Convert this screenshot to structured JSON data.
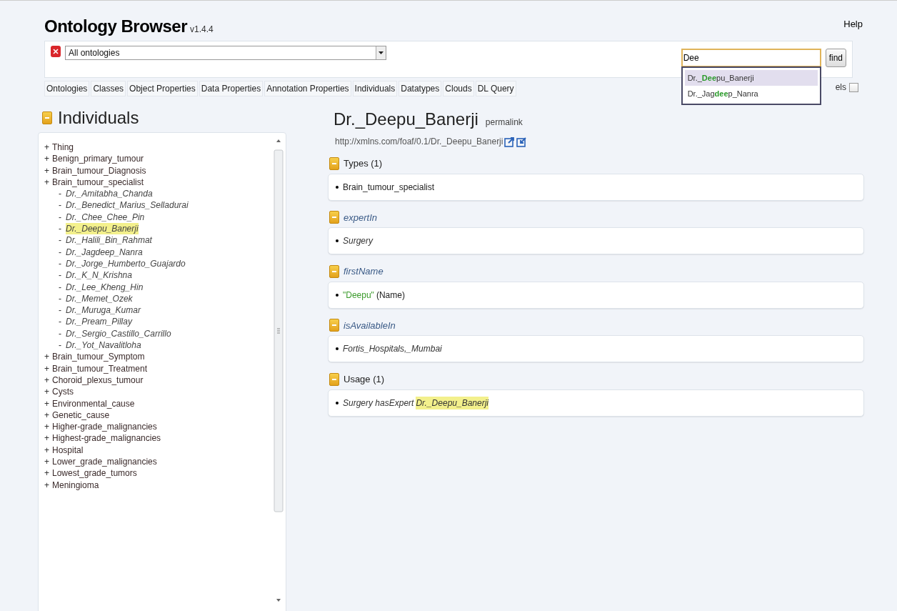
{
  "header": {
    "title": "Ontology Browser",
    "version": "v1.4.4",
    "help": "Help"
  },
  "toolbar": {
    "ontology_select": {
      "value": "All ontologies"
    },
    "search": {
      "value": "Dee"
    },
    "find_button": "find",
    "suggestions": [
      {
        "selected": true,
        "parts": [
          {
            "text": "Dr._",
            "match": false
          },
          {
            "text": "Dee",
            "match": true
          },
          {
            "text": "pu_Banerji",
            "match": false
          }
        ]
      },
      {
        "selected": false,
        "parts": [
          {
            "text": "Dr._Jag",
            "match": false
          },
          {
            "text": "dee",
            "match": true
          },
          {
            "text": "p_Nanra",
            "match": false
          }
        ]
      }
    ],
    "render_labels": {
      "label": "els",
      "checked": false
    }
  },
  "tabs": [
    "Ontologies",
    "Classes",
    "Object Properties",
    "Data Properties",
    "Annotation Properties",
    "Individuals",
    "Datatypes",
    "Clouds",
    "DL Query"
  ],
  "sidebar": {
    "title": "Individuals",
    "tree": [
      {
        "marker": "+",
        "label": "Thing"
      },
      {
        "marker": "+",
        "label": "Benign_primary_tumour"
      },
      {
        "marker": "+",
        "label": "Brain_tumour_Diagnosis"
      },
      {
        "marker": "+",
        "label": "Brain_tumour_specialist",
        "children": [
          {
            "marker": "-",
            "label": "Dr._Amitabha_Chanda",
            "selected": false
          },
          {
            "marker": "-",
            "label": "Dr._Benedict_Marius_Selladurai",
            "selected": false
          },
          {
            "marker": "-",
            "label": "Dr._Chee_Chee_Pin",
            "selected": false
          },
          {
            "marker": "-",
            "label": "Dr._Deepu_Banerji",
            "selected": true
          },
          {
            "marker": "-",
            "label": "Dr._Halili_Bin_Rahmat",
            "selected": false
          },
          {
            "marker": "-",
            "label": "Dr._Jagdeep_Nanra",
            "selected": false
          },
          {
            "marker": "-",
            "label": "Dr._Jorge_Humberto_Guajardo",
            "selected": false
          },
          {
            "marker": "-",
            "label": "Dr._K_N_Krishna",
            "selected": false
          },
          {
            "marker": "-",
            "label": "Dr._Lee_Kheng_Hin",
            "selected": false
          },
          {
            "marker": "-",
            "label": "Dr._Memet_Ozek",
            "selected": false
          },
          {
            "marker": "-",
            "label": "Dr._Muruga_Kumar",
            "selected": false
          },
          {
            "marker": "-",
            "label": "Dr._Pream_Pillay",
            "selected": false
          },
          {
            "marker": "-",
            "label": "Dr._Sergio_Castillo_Carrillo",
            "selected": false
          },
          {
            "marker": "-",
            "label": "Dr._Yot_Navalitloha",
            "selected": false
          }
        ]
      },
      {
        "marker": "+",
        "label": "Brain_tumour_Symptom"
      },
      {
        "marker": "+",
        "label": "Brain_tumour_Treatment"
      },
      {
        "marker": "+",
        "label": "Choroid_plexus_tumour"
      },
      {
        "marker": "+",
        "label": "Cysts"
      },
      {
        "marker": "+",
        "label": "Environmental_cause"
      },
      {
        "marker": "+",
        "label": "Genetic_cause"
      },
      {
        "marker": "+",
        "label": "Higher-grade_malignancies"
      },
      {
        "marker": "+",
        "label": "Highest-grade_malignancies"
      },
      {
        "marker": "+",
        "label": "Hospital"
      },
      {
        "marker": "+",
        "label": "Lower_grade_malignancies"
      },
      {
        "marker": "+",
        "label": "Lowest_grade_tumors"
      },
      {
        "marker": "+",
        "label": "Meningioma"
      }
    ]
  },
  "entity": {
    "name": "Dr._Deepu_Banerji",
    "permalink": "permalink",
    "uri": "http://xmlns.com/foaf/0.1/Dr._Deepu_Banerji",
    "sections": [
      {
        "title": "Types (1)",
        "kind": "group",
        "items": [
          [
            {
              "text": "Brain_tumour_specialist",
              "kind": "plain"
            }
          ]
        ]
      },
      {
        "title": "expertIn",
        "kind": "property",
        "items": [
          [
            {
              "text": "Surgery",
              "kind": "italic"
            }
          ]
        ]
      },
      {
        "title": "firstName",
        "kind": "property",
        "items": [
          [
            {
              "text": "\"Deepu\"",
              "kind": "literal"
            },
            {
              "text": "(Name)",
              "kind": "plain"
            }
          ]
        ]
      },
      {
        "title": "isAvailableIn",
        "kind": "property",
        "items": [
          [
            {
              "text": "Fortis_Hospitals,_Mumbai",
              "kind": "italic"
            }
          ]
        ]
      },
      {
        "title": "Usage (1)",
        "kind": "group",
        "items": [
          [
            {
              "text": "Surgery hasExpert",
              "kind": "italic"
            },
            {
              "text": "Dr._Deepu_Banerji",
              "kind": "highlight"
            }
          ]
        ]
      }
    ]
  }
}
